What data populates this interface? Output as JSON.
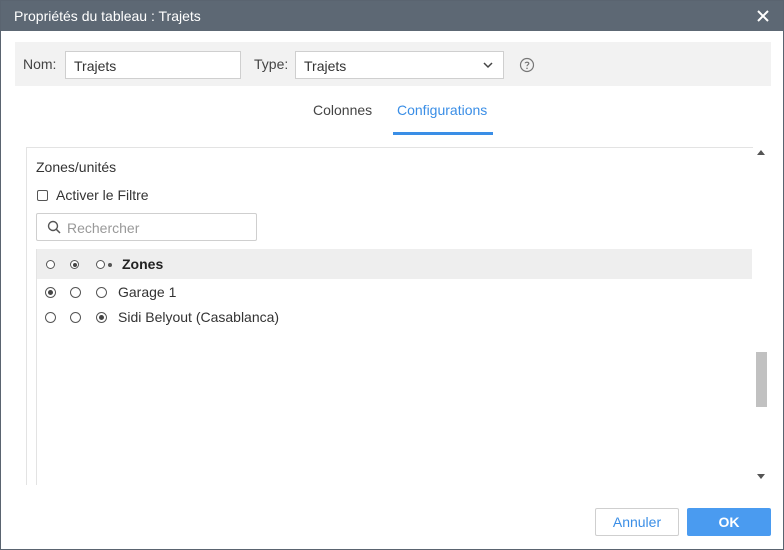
{
  "window": {
    "title": "Propriétés du tableau : Trajets"
  },
  "form": {
    "name_label": "Nom:",
    "name_value": "Trajets",
    "type_label": "Type:",
    "type_value": "Trajets"
  },
  "tabs": [
    {
      "label": "Colonnes",
      "active": false
    },
    {
      "label": "Configurations",
      "active": true
    }
  ],
  "section": {
    "title": "Zones/unités",
    "filter_checkbox_label": "Activer le Filtre",
    "filter_checked": false,
    "search_placeholder": "Rechercher"
  },
  "list": {
    "header_label": "Zones",
    "rows": [
      {
        "label": "Garage 1",
        "selected_column": 0
      },
      {
        "label": "Sidi Belyout (Casablanca)",
        "selected_column": 2
      }
    ]
  },
  "buttons": {
    "cancel_label": "Annuler",
    "ok_label": "OK"
  },
  "colors": {
    "titlebar": "#5d6874",
    "accent": "#3a8ee6",
    "ok_button": "#4a9bf0"
  }
}
